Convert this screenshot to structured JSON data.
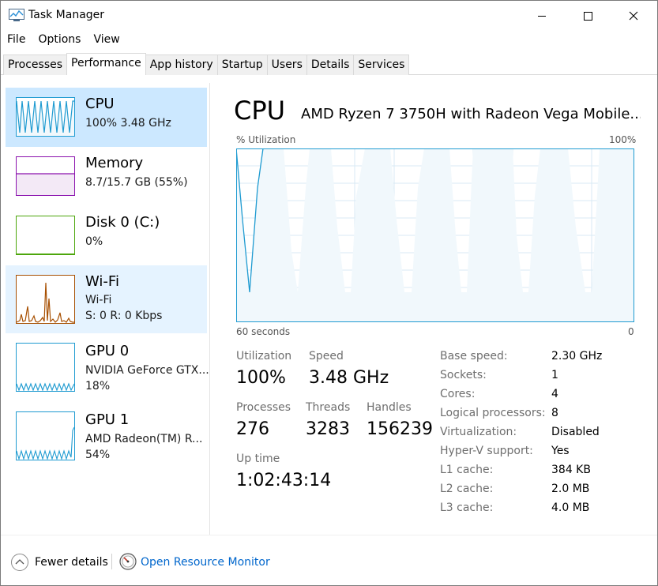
{
  "window": {
    "title": "Task Manager"
  },
  "menu": [
    "File",
    "Options",
    "View"
  ],
  "tabs": [
    "Processes",
    "Performance",
    "App history",
    "Startup",
    "Users",
    "Details",
    "Services"
  ],
  "sidebar": {
    "cpu": {
      "title": "CPU",
      "line1": "100%  3.48 GHz"
    },
    "memory": {
      "title": "Memory",
      "line1": "8.7/15.7 GB (55%)"
    },
    "disk": {
      "title": "Disk 0 (C:)",
      "line1": "0%"
    },
    "wifi": {
      "title": "Wi-Fi",
      "line1": "Wi-Fi",
      "line2": "S: 0 R: 0 Kbps"
    },
    "gpu0": {
      "title": "GPU 0",
      "line1": "NVIDIA GeForce GTX...",
      "line2": "18%"
    },
    "gpu1": {
      "title": "GPU 1",
      "line1": "AMD Radeon(TM) R...",
      "line2": "54%"
    }
  },
  "main": {
    "title": "CPU",
    "cpu_name": "AMD Ryzen 7 3750H with Radeon Vega Mobile...",
    "util_label": "% Utilization",
    "util_max": "100%",
    "time_label": "60 seconds",
    "time_end": "0",
    "stats": {
      "utilization_label": "Utilization",
      "utilization": "100%",
      "speed_label": "Speed",
      "speed": "3.48 GHz",
      "processes_label": "Processes",
      "processes": "276",
      "threads_label": "Threads",
      "threads": "3283",
      "handles_label": "Handles",
      "handles": "156239",
      "uptime_label": "Up time",
      "uptime": "1:02:43:14"
    },
    "info": [
      {
        "label": "Base speed:",
        "value": "2.30 GHz"
      },
      {
        "label": "Sockets:",
        "value": "1"
      },
      {
        "label": "Cores:",
        "value": "4"
      },
      {
        "label": "Logical processors:",
        "value": "8"
      },
      {
        "label": "Virtualization:",
        "value": "Disabled"
      },
      {
        "label": "Hyper-V support:",
        "value": "Yes"
      },
      {
        "label": "L1 cache:",
        "value": "384 KB"
      },
      {
        "label": "L2 cache:",
        "value": "2.0 MB"
      },
      {
        "label": "L3 cache:",
        "value": "4.0 MB"
      }
    ]
  },
  "footer": {
    "fewer_details": "Fewer details",
    "open_resource_monitor": "Open Resource Monitor"
  },
  "colors": {
    "cpu": "#1f9bd1",
    "memory": "#8b12ae",
    "disk": "#4da60c",
    "wifi": "#a74f01",
    "gpu": "#1f9bd1",
    "selected": "#cce8ff",
    "link": "#0066cc"
  }
}
